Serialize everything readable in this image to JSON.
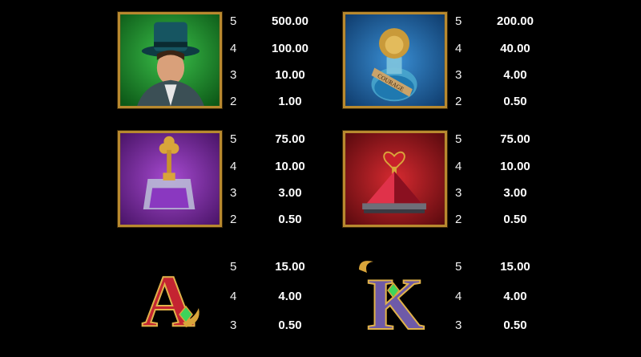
{
  "paytable": {
    "symbols": [
      {
        "id": "magician",
        "icon": "magician-top-hat-icon",
        "bg": "#1d8a2c",
        "payouts": [
          {
            "count": "5",
            "value": "500.00"
          },
          {
            "count": "4",
            "value": "100.00"
          },
          {
            "count": "3",
            "value": "10.00"
          },
          {
            "count": "2",
            "value": "1.00"
          }
        ]
      },
      {
        "id": "lion-potion",
        "icon": "lion-potion-bottle-icon",
        "bg": "#1f5e9c",
        "label": "COURAGE",
        "payouts": [
          {
            "count": "5",
            "value": "200.00"
          },
          {
            "count": "4",
            "value": "40.00"
          },
          {
            "count": "3",
            "value": "4.00"
          },
          {
            "count": "2",
            "value": "0.50"
          }
        ]
      },
      {
        "id": "purple-perfume",
        "icon": "club-perfume-bottle-icon",
        "bg": "#7a2a9e",
        "payouts": [
          {
            "count": "5",
            "value": "75.00"
          },
          {
            "count": "4",
            "value": "10.00"
          },
          {
            "count": "3",
            "value": "3.00"
          },
          {
            "count": "2",
            "value": "0.50"
          }
        ]
      },
      {
        "id": "red-pyramid",
        "icon": "heart-pyramid-gem-icon",
        "bg": "#a0161c",
        "payouts": [
          {
            "count": "5",
            "value": "75.00"
          },
          {
            "count": "4",
            "value": "10.00"
          },
          {
            "count": "3",
            "value": "3.00"
          },
          {
            "count": "2",
            "value": "0.50"
          }
        ]
      },
      {
        "id": "ace",
        "icon": "letter-a-icon",
        "letter": "A",
        "payouts": [
          {
            "count": "5",
            "value": "15.00"
          },
          {
            "count": "4",
            "value": "4.00"
          },
          {
            "count": "3",
            "value": "0.50"
          }
        ]
      },
      {
        "id": "king",
        "icon": "letter-k-icon",
        "letter": "K",
        "payouts": [
          {
            "count": "5",
            "value": "15.00"
          },
          {
            "count": "4",
            "value": "4.00"
          },
          {
            "count": "3",
            "value": "0.50"
          }
        ]
      }
    ]
  }
}
